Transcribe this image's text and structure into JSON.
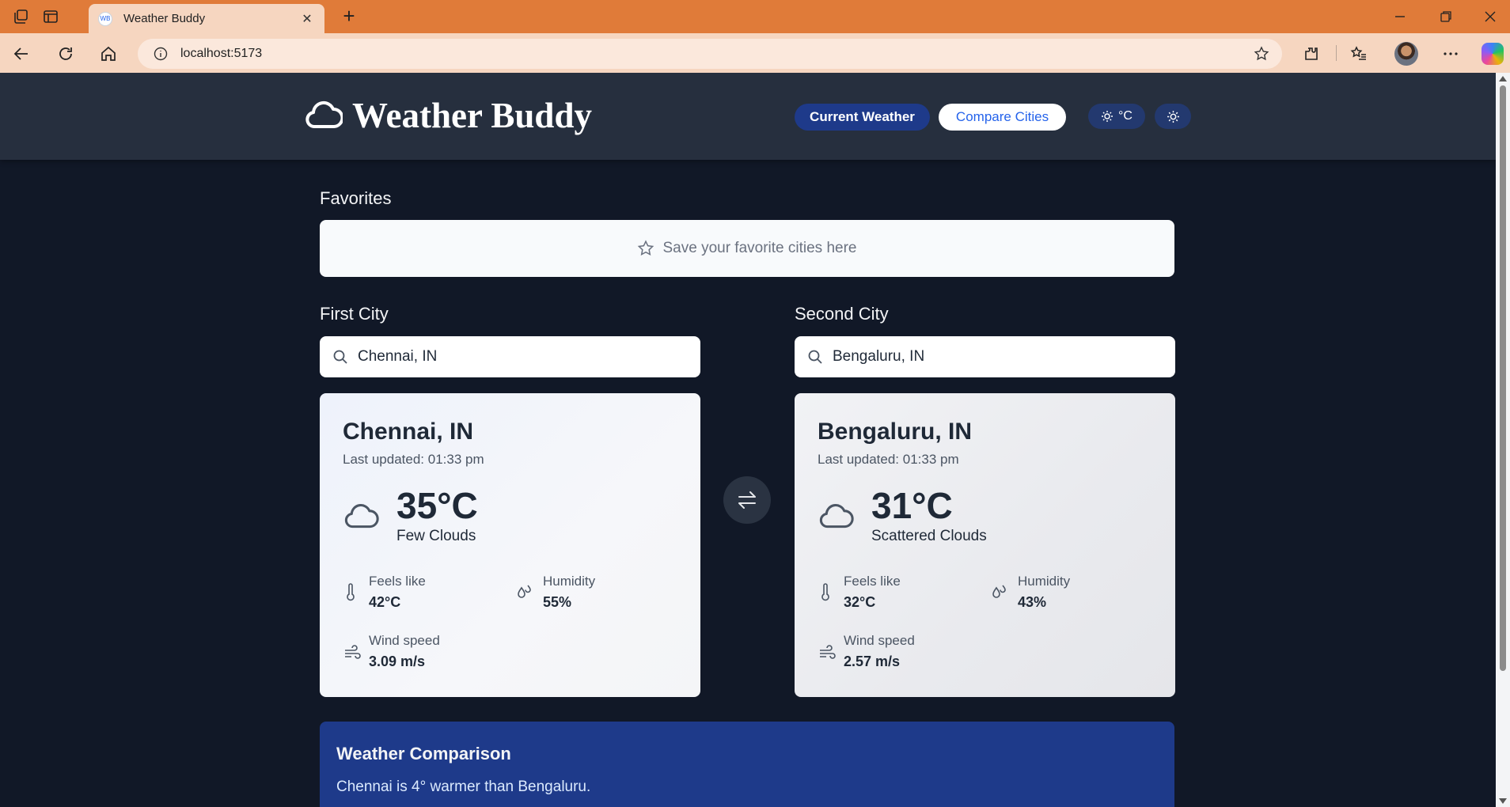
{
  "browser": {
    "tab_title": "Weather Buddy",
    "tab_favicon": "WB",
    "url": "localhost:5173"
  },
  "app": {
    "title": "Weather Buddy",
    "logo_icon": "cloud-icon",
    "nav": {
      "current_weather": "Current Weather",
      "compare_cities": "Compare Cities"
    },
    "unit_toggle": "°C",
    "theme_icon": "sun-icon"
  },
  "favorites": {
    "heading": "Favorites",
    "empty_text": "Save your favorite cities here"
  },
  "first_city": {
    "heading": "First City",
    "search_value": "Chennai, IN",
    "name": "Chennai, IN",
    "updated": "Last updated: 01:33 pm",
    "temp": "35°C",
    "condition": "Few Clouds",
    "feels_like_label": "Feels like",
    "feels_like": "42°C",
    "humidity_label": "Humidity",
    "humidity": "55%",
    "wind_label": "Wind speed",
    "wind": "3.09 m/s"
  },
  "second_city": {
    "heading": "Second City",
    "search_value": "Bengaluru, IN",
    "name": "Bengaluru, IN",
    "updated": "Last updated: 01:33 pm",
    "temp": "31°C",
    "condition": "Scattered Clouds",
    "feels_like_label": "Feels like",
    "feels_like": "32°C",
    "humidity_label": "Humidity",
    "humidity": "43%",
    "wind_label": "Wind speed",
    "wind": "2.57 m/s"
  },
  "comparison": {
    "title": "Weather Comparison",
    "text": "Chennai is 4° warmer than Bengaluru."
  },
  "colors": {
    "page_bg": "#111827",
    "header_bg": "#262f3e",
    "accent_blue": "#1e3a8a",
    "link_blue": "#2563eb",
    "titlebar": "#e07b39"
  }
}
